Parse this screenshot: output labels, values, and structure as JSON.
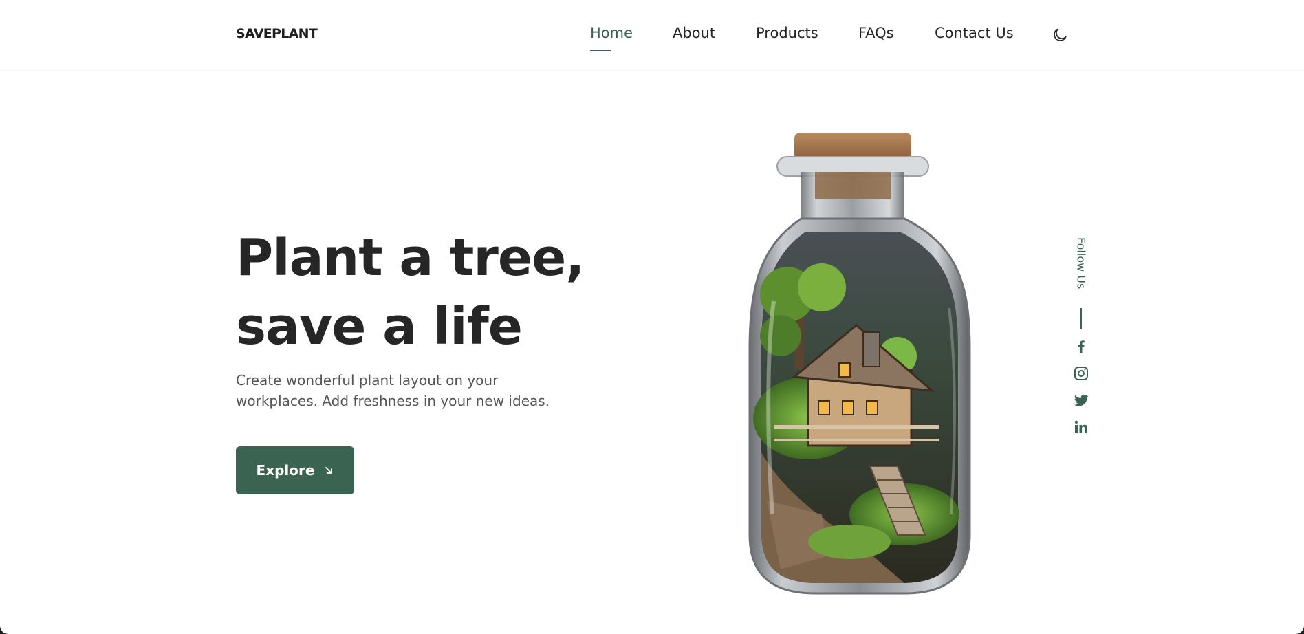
{
  "brand": {
    "logo": "SAVEPLANT"
  },
  "nav": {
    "items": [
      {
        "label": "Home",
        "active": true
      },
      {
        "label": "About"
      },
      {
        "label": "Products"
      },
      {
        "label": "FAQs"
      },
      {
        "label": "Contact Us"
      }
    ],
    "theme_toggle_icon": "moon-icon"
  },
  "hero": {
    "title_line1": "Plant a tree,",
    "title_line2": "save a life",
    "description": "Create wonderful plant layout on your workplaces. Add freshness in your new ideas.",
    "cta_label": "Explore",
    "cta_icon": "arrow-down-right-icon",
    "image": "terrarium-bottle-with-miniature-house"
  },
  "follow": {
    "label": "Follow Us",
    "socials": [
      "facebook-icon",
      "instagram-icon",
      "twitter-icon",
      "linkedin-icon"
    ]
  },
  "colors": {
    "accent": "#3a6351",
    "text": "#262626",
    "muted": "#555555",
    "background": "#ffffff"
  }
}
